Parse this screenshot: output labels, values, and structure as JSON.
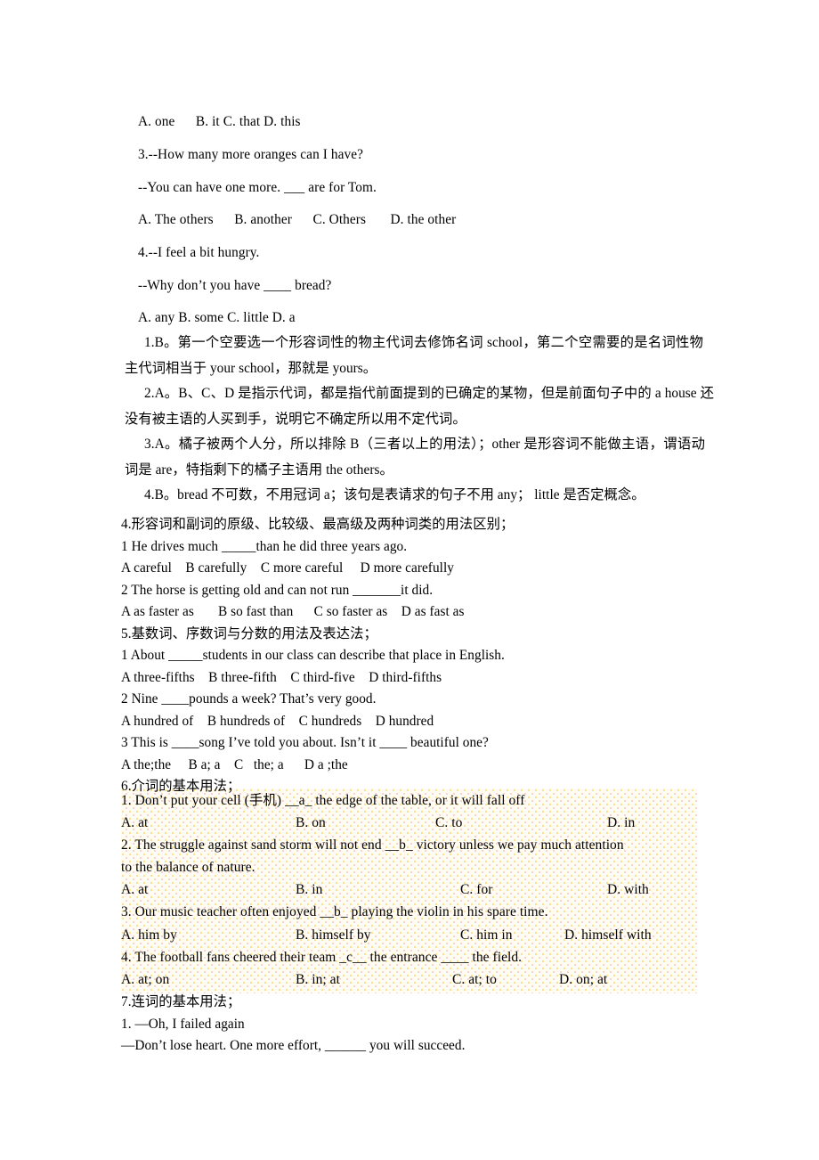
{
  "document": {
    "type": "english-grammar-worksheet",
    "background_color": "#ffffff",
    "text_color": "#000000",
    "highlight_color": "#fffdf3"
  },
  "pronoun_questions": {
    "q2_options": "A. one      B. it C. that D. this",
    "q3_stem": "3.--How many more oranges can I have?",
    "q3_reply": "--You can have one more. ___ are for Tom.",
    "q3_options": "A. The others      B. another      C. Others       D. the other",
    "q4_stem": "4.--I feel a bit hungry.",
    "q4_reply": "--Why don’t you have ____ bread?",
    "q4_options": "A. any B. some C. little D. a"
  },
  "explanations": {
    "e1": "1.B。第一个空要选一个形容词性的物主代词去修饰名词 school，第二个空需要的是名词性物主代词相当于 your school，那就是 yours。",
    "e2": "2.A。B、C、D 是指示代词，都是指代前面提到的已确定的某物，但是前面句子中的 a house 还没有被主语的人买到手，说明它不确定所以用不定代词。",
    "e3": "3.A。橘子被两个人分，所以排除 B（三者以上的用法）；other 是形容词不能做主语，谓语动词是 are，特指剩下的橘子主语用 the others。",
    "e4": "4.B。bread 不可数，不用冠词 a；该句是表请求的句子不用 any；  little 是否定概念。"
  },
  "section4": {
    "heading": "4.形容词和副词的原级、比较级、最高级及两种词类的用法区别；",
    "q1_stem": "1 He drives much _____than he did three years ago.",
    "q1_options": "A careful    B carefully    C more careful     D more carefully",
    "q2_stem": "2 The horse is getting old and can not run _______it did.",
    "q2_options": "A as faster as       B so fast than      C so faster as    D as fast as"
  },
  "section5": {
    "heading": "5.基数词、序数词与分数的用法及表达法；",
    "q1_stem": "1 About _____students in our class can describe that place in English.",
    "q1_options": "A three-fifths    B three-fifth    C third-five    D third-fifths",
    "q2_stem": "2 Nine ____pounds a week? That’s very good.",
    "q2_options": "A hundred of    B hundreds of    C hundreds    D hundred",
    "q3_stem": "3 This is ____song I’ve told you about. Isn’t it ____ beautiful one?",
    "q3_options": "A the;the     B a; a    C   the; a      D a ;the"
  },
  "section6": {
    "heading": "6.介词的基本用法；",
    "questions": [
      {
        "stem": "1. Don’t put your cell (手机) __a_ the edge of the table, or it will fall off",
        "options": [
          "A. at",
          "B. on",
          "C. to",
          "D. in"
        ]
      },
      {
        "stem": "2. The struggle against sand storm will not end __b_ victory unless we pay much attention",
        "stem_cont": "to the balance of nature.",
        "options": [
          "A. at",
          "B. in",
          "C. for",
          "D. with"
        ]
      },
      {
        "stem": "3. Our music teacher often enjoyed __b_ playing the violin in his spare time.",
        "options": [
          "A. him by",
          "B. himself by",
          "C. him in",
          "D. himself with"
        ]
      },
      {
        "stem": "4. The football fans cheered their team _c__ the entrance ____ the field.",
        "options": [
          "A. at; on",
          "B. in; at",
          "C. at; to",
          "D. on; at"
        ]
      }
    ]
  },
  "section7": {
    "heading": "7.连词的基本用法；",
    "q1_stem": "1. —Oh, I failed again",
    "q1_reply": "—Don’t lose heart. One more effort, ______ you will succeed."
  }
}
